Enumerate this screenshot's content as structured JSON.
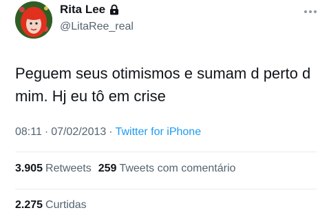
{
  "user": {
    "display_name": "Rita Lee",
    "handle": "@LitaRee_real",
    "lock_icon": "lock-icon"
  },
  "tweet": {
    "text": "Peguem seus otimismos e sumam d perto d mim. Hj eu tô em crise",
    "time": "08:11",
    "date": "07/02/2013",
    "separator": "·",
    "source": "Twitter for iPhone"
  },
  "stats": {
    "retweets_count": "3.905",
    "retweets_label": "Retweets",
    "quotes_count": "259",
    "quotes_label": "Tweets com comentário",
    "likes_count": "2.275",
    "likes_label": "Curtidas"
  },
  "colors": {
    "text": "#0f1419",
    "secondary": "#536471",
    "link": "#1d9bf0"
  }
}
